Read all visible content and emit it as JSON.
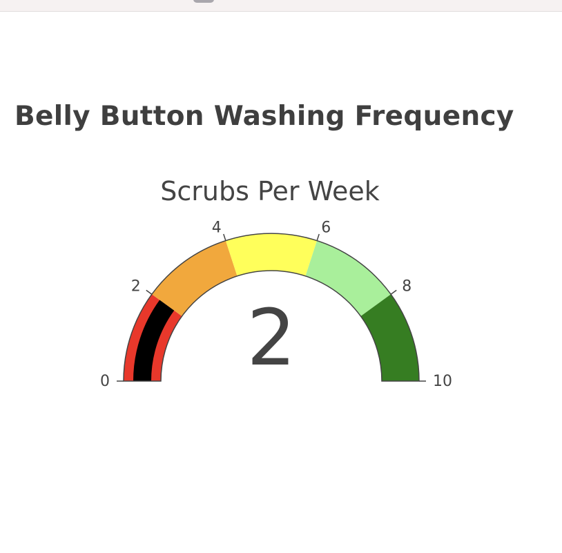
{
  "panel": {
    "title": "Belly Button Washing Frequency"
  },
  "chart_data": {
    "type": "gauge",
    "title": "Scrubs Per Week",
    "value": 2,
    "value_label": "2",
    "range": [
      0,
      10
    ],
    "ticks": [
      0,
      2,
      4,
      6,
      8,
      10
    ],
    "tick_labels": [
      "0",
      "2",
      "4",
      "6",
      "8",
      "10"
    ],
    "bar_color": "#000000",
    "steps": [
      {
        "range": [
          0,
          2
        ],
        "color": "#e8382b"
      },
      {
        "range": [
          2,
          4
        ],
        "color": "#f1a83d"
      },
      {
        "range": [
          4,
          6
        ],
        "color": "#ffff5b"
      },
      {
        "range": [
          6,
          8
        ],
        "color": "#a9ef9b"
      },
      {
        "range": [
          8,
          10
        ],
        "color": "#367d22"
      }
    ],
    "outline_color": "#444444"
  }
}
